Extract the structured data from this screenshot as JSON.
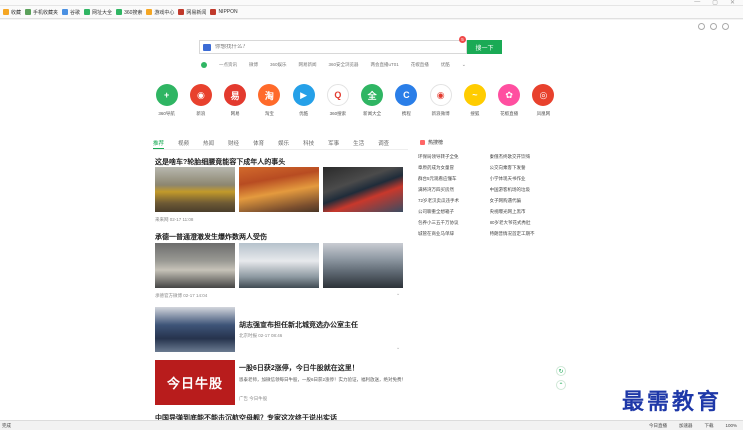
{
  "bookmarks": [
    {
      "label": "收藏",
      "color": "#f5a623"
    },
    {
      "label": "手机收藏夹",
      "color": "#5aa05a"
    },
    {
      "label": "谷歌",
      "color": "#4a90e2"
    },
    {
      "label": "网址大全",
      "color": "#2fb563"
    },
    {
      "label": "360搜索",
      "color": "#2fb563"
    },
    {
      "label": "游戏中心",
      "color": "#f5a623"
    },
    {
      "label": "网易新闻",
      "color": "#c0392b"
    },
    {
      "label": "NIPPON",
      "color": "#c0392b"
    }
  ],
  "search": {
    "placeholder": "你想找什么？",
    "button": "搜一下",
    "badge": "5"
  },
  "quick_links": [
    "一点资讯",
    "微博",
    "360娱乐",
    "网易新闻",
    "360安全浏览器",
    "两会直播uT01",
    "花椒直播",
    "优酷"
  ],
  "apps": [
    {
      "label": "360导航",
      "color": "#2fb563",
      "glyph": "+"
    },
    {
      "label": "新浪",
      "color": "#e8412d",
      "glyph": "◉"
    },
    {
      "label": "网易",
      "color": "#e33a2e",
      "glyph": "易"
    },
    {
      "label": "淘宝",
      "color": "#ff6a2a",
      "glyph": "淘"
    },
    {
      "label": "优酷",
      "color": "#25a0e8",
      "glyph": "▶"
    },
    {
      "label": "360搜索",
      "color": "#ffffff",
      "glyph": "Q"
    },
    {
      "label": "新闻大全",
      "color": "#2fb563",
      "glyph": "全"
    },
    {
      "label": "携程",
      "color": "#2a7ee8",
      "glyph": "C"
    },
    {
      "label": "新浪微博",
      "color": "#ffffff",
      "glyph": "◉"
    },
    {
      "label": "搜狐",
      "color": "#ffcc00",
      "glyph": "~"
    },
    {
      "label": "花椒直播",
      "color": "#ff4fa0",
      "glyph": "✿"
    },
    {
      "label": "凤凰网",
      "color": "#e8412d",
      "glyph": "◎"
    }
  ],
  "news_tabs": [
    "推荐",
    "视频",
    "热闻",
    "财经",
    "体育",
    "娱乐",
    "科技",
    "军事",
    "生活",
    "调查"
  ],
  "hot": {
    "title": "热搜榜",
    "items": [
      "环保局领导转子全免",
      "秦俄杰终歌交开饮嗨",
      "章原药成为女童冒",
      "公交向乘客下发誓",
      "群台5元观看应懂车",
      "小学体现天书作业",
      "满将湾万四买房然",
      "中国游客机场的垃圾",
      "72岁老汉卖瓜违手术",
      "女子网购遇代骗",
      "公司聊重全想箱子",
      "央视曝光网上黑市",
      "包养小三五千万协议",
      "80岁老大爷花式秀肚",
      "城管在商业马单辞",
      "特朗普情况首定工期不"
    ]
  },
  "articles": [
    {
      "title": "这是啥车?轮胎细腰竟能容下成年人的事头",
      "meta": "来来网  02-17 11:08"
    },
    {
      "title": "承德一普通澄澈发生爆炸数两人受伤",
      "meta": "承德官方微博  02-17 14:04"
    },
    {
      "title": "胡志强宣布担任新北城竞选办公室主任",
      "meta": "北京时报  02-17 08:46"
    },
    {
      "title": "一股6日获2涨停，今日牛股就在这里！",
      "desc": "恩泰老师，加微信领每日牛股，一股6日获2涨停！实力验证，福利放送，绝对免费！",
      "meta": "广告  今日牛股",
      "image_text": "今日牛股"
    },
    {
      "title": "中国导弹到底能不能击沉航空母舰？专家这次终于说出实话"
    }
  ],
  "status": {
    "left": "完成",
    "right": [
      "今日直播",
      "加速器",
      "下载",
      "100%"
    ]
  },
  "watermark": "最需教育"
}
